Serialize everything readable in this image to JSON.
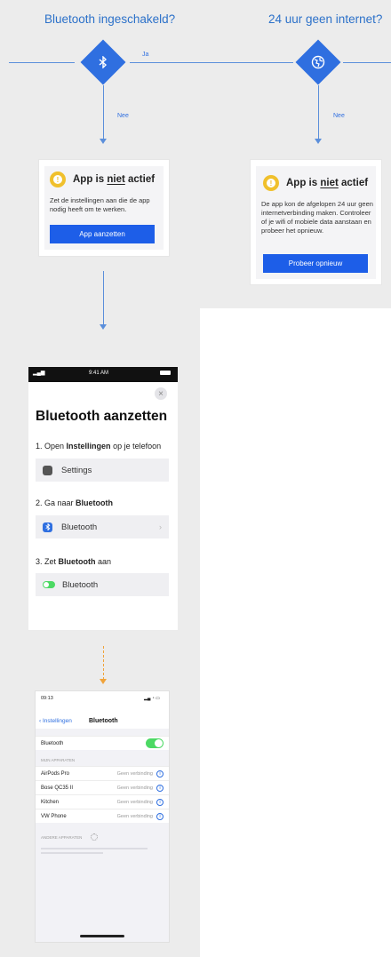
{
  "decision_bluetooth": {
    "question": "Bluetooth ingeschakeld?",
    "yes_label": "Ja",
    "no_label": "Nee"
  },
  "decision_internet": {
    "question": "24 uur geen internet?",
    "no_label": "Nee"
  },
  "card_bluetooth": {
    "title_prefix": "App is",
    "title_emph": "niet",
    "title_suffix": "actief",
    "body": "Zet de instellingen aan die de app nodig heeft om te werken.",
    "button": "App aanzetten"
  },
  "card_internet": {
    "title_prefix": "App is",
    "title_emph": "niet",
    "title_suffix": "actief",
    "body": "De app kon de afgelopen 24 uur geen internetverbinding maken. Controleer of je wifi of mobiele data aanstaan en probeer het opnieuw.",
    "button": "Probeer opnieuw"
  },
  "phone_instructions": {
    "status_time": "9:41 AM",
    "title": "Bluetooth aanzetten",
    "step1_prefix": "1. Open",
    "step1_bold": "Instellingen",
    "step1_suffix": "op je telefoon",
    "step1_row": "Settings",
    "step2_prefix": "2. Ga naar",
    "step2_bold": "Bluetooth",
    "step2_row": "Bluetooth",
    "step3_prefix": "3. Zet",
    "step3_bold": "Bluetooth",
    "step3_suffix": "aan",
    "step3_row": "Bluetooth"
  },
  "phone_settings": {
    "status_time": "09:13",
    "back_label": "Instellingen",
    "title": "Bluetooth",
    "bt_row": "Bluetooth",
    "devices_header": "MIJN APPARATEN",
    "devices": [
      {
        "name": "AirPods Pro",
        "status": "Geen verbinding"
      },
      {
        "name": "Bose QC35 II",
        "status": "Geen verbinding"
      },
      {
        "name": "Kitchen",
        "status": "Geen verbinding"
      },
      {
        "name": "VW Phone",
        "status": "Geen verbinding"
      }
    ],
    "other_header": "ANDERE APPARATEN"
  },
  "colors": {
    "accent": "#2f6fe0",
    "button": "#1d5ee8",
    "warning": "#f0c02c",
    "toggle_on": "#4cd964",
    "panel": "#ececec"
  }
}
